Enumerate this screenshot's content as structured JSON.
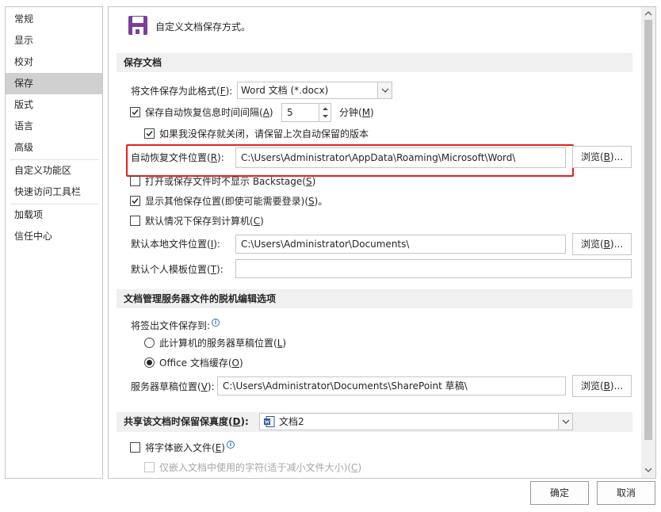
{
  "nav": {
    "items": [
      "常规",
      "显示",
      "校对",
      "保存",
      "版式",
      "语言",
      "高级",
      "自定义功能区",
      "快速访问工具栏",
      "加载项",
      "信任中心"
    ],
    "selected_index": 3
  },
  "header": {
    "text": "自定义文档保存方式。"
  },
  "save_section": {
    "title": "保存文档",
    "format_label": "将文件保存为此格式(",
    "format_key": "F",
    "format_value": "Word 文档 (*.docx)",
    "autorecover_label": "保存自动恢复信息时间间隔(",
    "autorecover_key": "A",
    "autorecover_minutes": "5",
    "minutes_label": "分钟(",
    "minutes_key": "M",
    "keep_version_label": "如果我没保存就关闭，请保留上次自动保留的版本",
    "autorecover_location_label": "自动恢复文件位置(",
    "autorecover_location_key": "R",
    "autorecover_location_value": "C:\\Users\\Administrator\\AppData\\Roaming\\Microsoft\\Word\\",
    "browse_label": "浏览(",
    "browse_key": "B",
    "no_backstage_label": "打开或保存文件时不显示 Backstage(",
    "no_backstage_key": "S",
    "show_other_locations_label": "显示其他保存位置(即使可能需要登录)(",
    "show_other_locations_key": "S",
    "show_other_locations_suffix": ")。",
    "default_computer_label": "默认情况下保存到计算机(",
    "default_computer_key": "C",
    "local_path_label": "默认本地文件位置(",
    "local_path_key": "I",
    "local_path_value": "C:\\Users\\Administrator\\Documents\\",
    "template_path_label": "默认个人模板位置(",
    "template_path_key": "T",
    "template_path_value": ""
  },
  "offline_section": {
    "title": "文档管理服务器文件的脱机编辑选项",
    "checkout_label": "将签出文件保存到:",
    "radio_server_label": "此计算机的服务器草稿位置(",
    "radio_server_key": "L",
    "radio_cache_label": "Office 文档缓存(",
    "radio_cache_key": "O",
    "drafts_label": "服务器草稿位置(",
    "drafts_key": "V",
    "drafts_value": "C:\\Users\\Administrator\\Documents\\SharePoint 草稿\\"
  },
  "fidelity_section": {
    "title": "共享该文档时保留保真度(",
    "title_key": "D",
    "document_value": "文档2",
    "embed_fonts_label": "将字体嵌入文件(",
    "embed_fonts_key": "E",
    "embed_used_label": "仅嵌入文档中使用的字符(适于减小文件大小)(",
    "embed_used_key": "C"
  },
  "footer": {
    "ok_label": "确定",
    "cancel_label": "取消"
  },
  "colors": {
    "highlight_box": "#e81f1f",
    "selected_nav": "#d0d0d0",
    "section_bg": "#f0f0f0",
    "save_icon": "#7b3f98"
  }
}
